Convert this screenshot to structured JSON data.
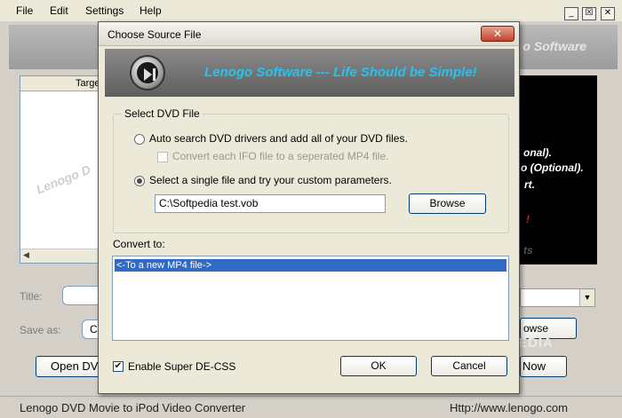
{
  "main_window": {
    "menu": [
      "File",
      "Edit",
      "Settings",
      "Help"
    ],
    "window_controls": [
      "_",
      "☒",
      "✕"
    ],
    "banner_text": "o Software",
    "list_header": "Targe",
    "list_watermark": "Lenogo D",
    "preview_lines": [
      "onal).",
      "o (Optional).",
      "rt.",
      "!",
      "ts"
    ],
    "title_label": "Title:",
    "save_as_label": "Save as:",
    "save_as_value": "C:",
    "browse_partial": "owse",
    "open_button_partial": "Open DV",
    "convert_button_partial": "Now",
    "status_left": "Lenogo DVD Movie to iPod Video Converter",
    "status_right": "Http://www.lenogo.com",
    "watermark": "SOFTPEDIA"
  },
  "dialog": {
    "title": "Choose Source File",
    "close_label": "✕",
    "banner_text": "Lenogo Software  ---  Life Should be Simple!",
    "group_title": "Select DVD File",
    "option_auto": "Auto search DVD drivers and add all of your DVD files.",
    "option_auto_sub": "Convert each IFO file to a seperated MP4 file.",
    "option_single": "Select a single file and try your custom parameters.",
    "file_path": "C:\\Softpedia test.vob",
    "browse_label": "Browse",
    "convert_to_label": "Convert to:",
    "convert_options": [
      "<-To a new MP4 file->"
    ],
    "decss_label": "Enable Super DE-CSS",
    "ok_label": "OK",
    "cancel_label": "Cancel"
  }
}
